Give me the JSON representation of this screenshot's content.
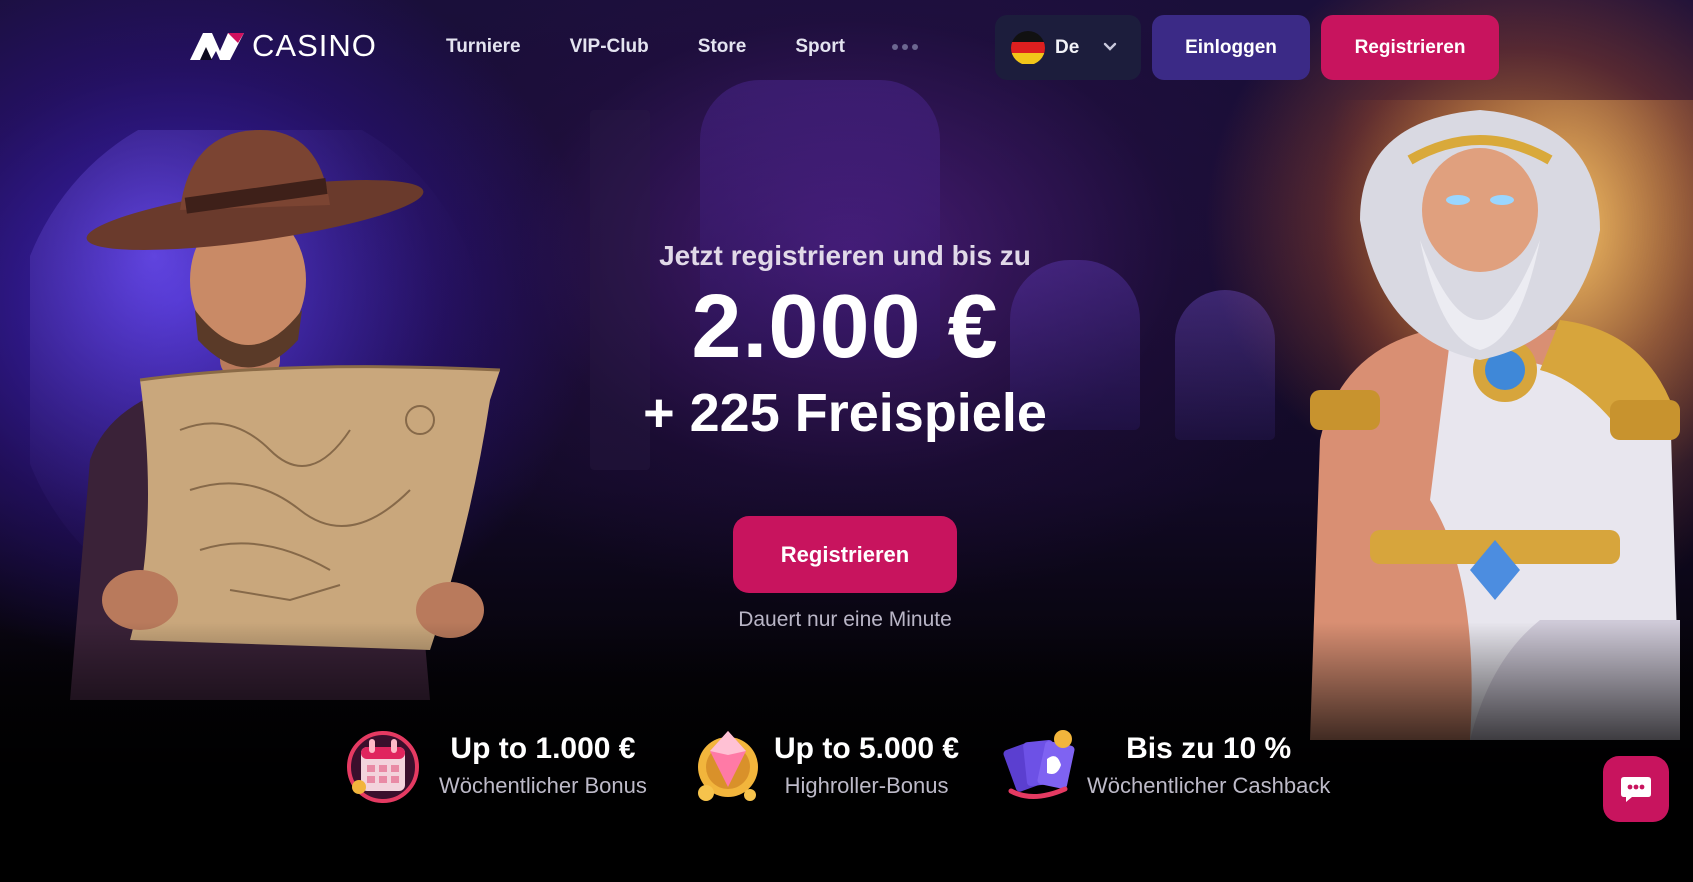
{
  "brand": {
    "logo_text": "CASINO",
    "accent": "#c8145e",
    "login_color": "#3b2a86"
  },
  "nav": {
    "items": [
      {
        "label": "Turniere"
      },
      {
        "label": "VIP-Club"
      },
      {
        "label": "Store"
      },
      {
        "label": "Sport"
      }
    ],
    "more_icon": "ellipsis-icon"
  },
  "language": {
    "label": "De",
    "flag": "germany-flag-icon"
  },
  "header": {
    "login_label": "Einloggen",
    "register_label": "Registrieren"
  },
  "promo": {
    "lead": "Jetzt registrieren und bis zu",
    "amount": "2.000 €",
    "spins": "+ 225 Freispiele",
    "cta_label": "Registrieren",
    "note": "Dauert nur eine Minute"
  },
  "benefits": [
    {
      "title": "Up to 1.000 €",
      "subtitle": "Wöchentlicher Bonus",
      "icon": "calendar-icon"
    },
    {
      "title": "Up to 5.000 €",
      "subtitle": "Highroller-Bonus",
      "icon": "gem-coin-icon"
    },
    {
      "title": "Bis zu 10 %",
      "subtitle": "Wöchentlicher Cashback",
      "icon": "cards-icon"
    }
  ],
  "chat": {
    "icon": "chat-icon"
  }
}
